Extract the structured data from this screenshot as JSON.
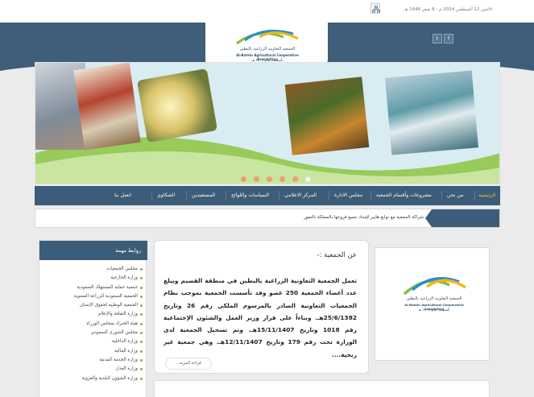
{
  "topbar": {
    "date": "الاثنين 12 أغسطس 2024 م - 8 صفر 1446 هـ"
  },
  "header": {
    "social": [
      {
        "name": "twitter",
        "glyph": "t"
      },
      {
        "name": "facebook",
        "glyph": "f"
      }
    ],
    "logo": {
      "arabic": "الجمعية التعاونية الزراعية بالبطين",
      "english": "Al-Batein Agricultural Cooperative Association",
      "established": "تأسست عام ١٤٠٧ هـ"
    }
  },
  "banner": {
    "slide_count": 6,
    "active_slide": 6
  },
  "nav": {
    "items": [
      {
        "label": "الرئيسية",
        "active": true
      },
      {
        "label": "من نحن",
        "active": false
      },
      {
        "label": "مشروعات وأقسام الجمعية",
        "active": false
      },
      {
        "label": "مجلس الادارة",
        "active": false
      },
      {
        "label": "المركز الاعلامي",
        "active": false
      },
      {
        "label": "السياسات واللوائح",
        "active": false
      },
      {
        "label": "المستفيدين",
        "active": false
      },
      {
        "label": "الشكاوي",
        "active": false
      },
      {
        "label": "اتصل بنا",
        "active": false
      }
    ]
  },
  "ticker": {
    "text": "شراكة الجمعية مع توابع هايبر لإمداد جميع فروعها بالمملكة بالتمور"
  },
  "about": {
    "title": "عن الجمعية :-",
    "text": "تعمل الجمعية التعاونية الزراعية بالبطين في منطقة القصيم ويبلغ عدد أعضاء الجمعية 250 عضو وقد تأسست الجمعية بموجب نظام الجمعيات التعاونية الصادر بالمرسوم الملكي رقم 26 وتاريخ 25/6/1382هـ. وبناءاً على قرار وزير العمل والشئون الإجتماعية رقم 1018 وتاريخ 15/11/1407هـ. وتم تسجيل الجمعية لدى الوزارة تحت رقم 179 وتاريخ 12/11/1407هـ. وهي جمعية غير ربحية....",
    "read_more": "قراءة المزيد..."
  },
  "links": {
    "title": "روابط مهمة",
    "items": [
      "مجلس الجمعيات",
      "وزارة الخارجية",
      "جمعية حماية المستهلك السعودية",
      "الجمعية السعودية للزراعة العضوية",
      "الجمعية الوطنية لحقوق الإنسان",
      "وزارة الثقافة والإعلام",
      "هيئة الخبراء بمجلس الوزراء",
      "مجلس الشورى السعودي",
      "وزارة الداخلية",
      "وزارة المالية",
      "وزارة الخدمة المدنية",
      "وزارة العدل",
      "وزارة الشؤون البلدية والقروية"
    ]
  },
  "colors": {
    "primary": "#3c5d79",
    "accent": "#f5c518",
    "bullet": "#7ab648",
    "dot": "#e8a26a"
  }
}
